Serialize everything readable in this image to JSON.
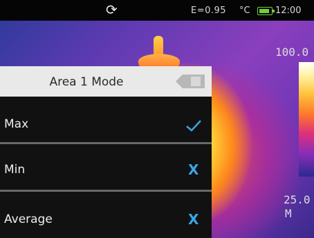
{
  "status_bar": {
    "refresh_icon": "refresh-icon",
    "emissivity": "E=0.95",
    "unit": "°C",
    "battery_icon": "battery-icon",
    "battery_color": "#6fcf3a",
    "time": "12:00"
  },
  "scale": {
    "max": "100.0",
    "min": "25.0",
    "mode": "M"
  },
  "menu": {
    "title": "Area 1 Mode",
    "back_icon": "back-icon",
    "items": [
      {
        "label": "Max",
        "state_icon": "check-icon",
        "selected": true
      },
      {
        "label": "Min",
        "state_icon": "x-icon",
        "state_text": "X",
        "selected": false
      },
      {
        "label": "Average",
        "state_icon": "x-icon",
        "state_text": "X",
        "selected": false
      }
    ]
  },
  "colors": {
    "accent": "#3aa6e6",
    "menu_header_bg": "#e9e9e9",
    "menu_item_bg": "#111111"
  }
}
